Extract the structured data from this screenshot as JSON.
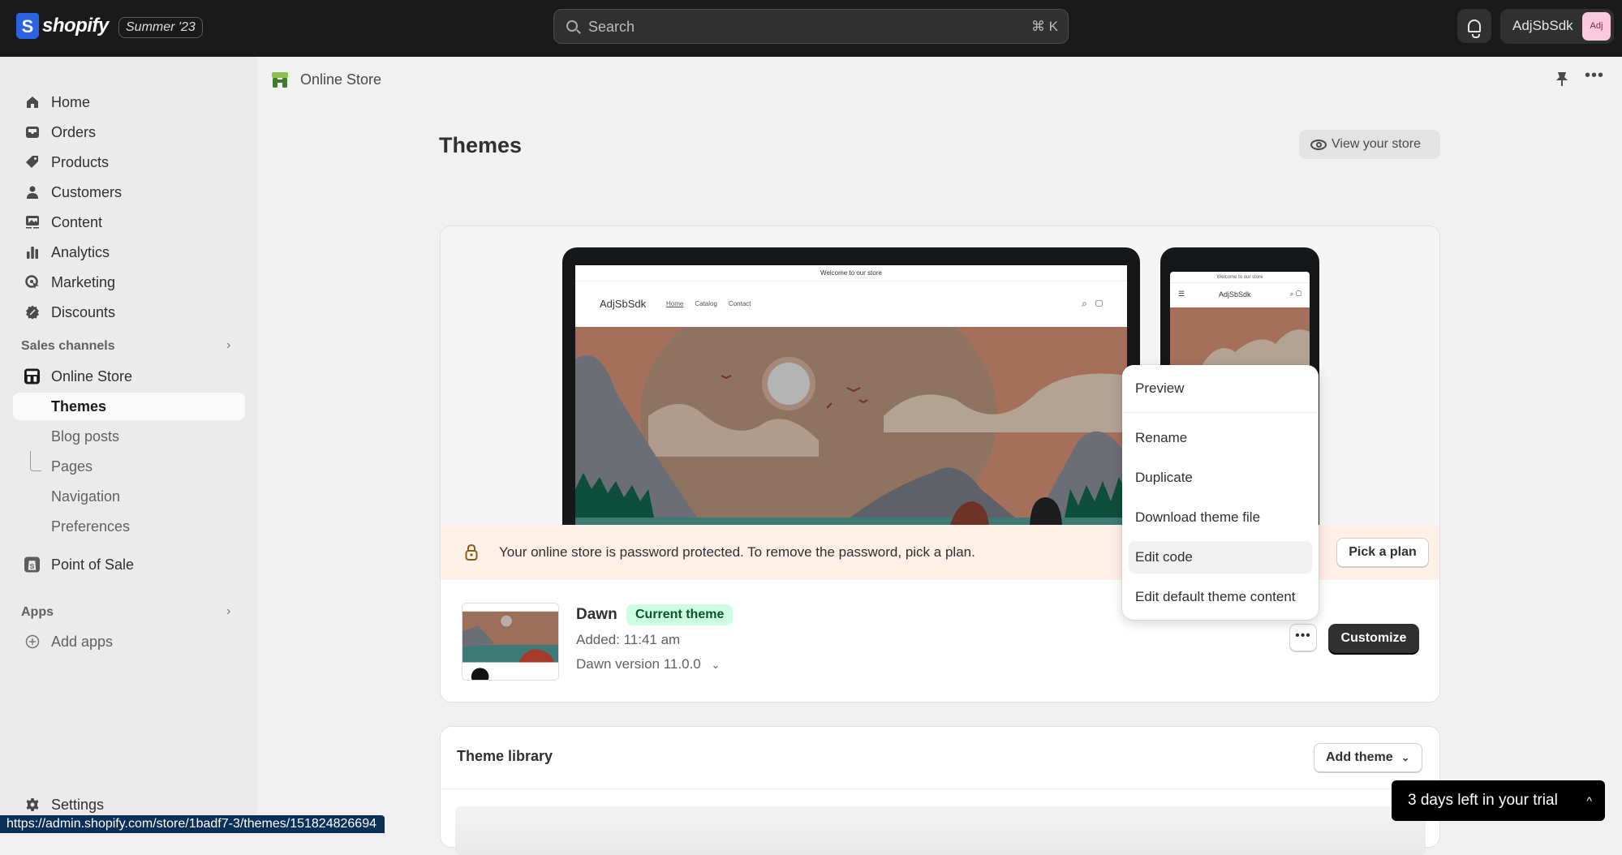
{
  "topbar": {
    "brand": "shopify",
    "edition": "Summer '23",
    "search_placeholder": "Search",
    "search_shortcut": "⌘ K",
    "account_name": "AdjSbSdk",
    "avatar_initials": "Adj"
  },
  "sidebar": {
    "main_items": [
      {
        "label": "Home",
        "icon": "home-icon"
      },
      {
        "label": "Orders",
        "icon": "inbox-icon"
      },
      {
        "label": "Products",
        "icon": "tag-icon"
      },
      {
        "label": "Customers",
        "icon": "person-icon"
      },
      {
        "label": "Content",
        "icon": "image-icon"
      },
      {
        "label": "Analytics",
        "icon": "bar-chart-icon"
      },
      {
        "label": "Marketing",
        "icon": "target-icon"
      },
      {
        "label": "Discounts",
        "icon": "discount-icon"
      }
    ],
    "sales_channels_heading": "Sales channels",
    "online_store": "Online Store",
    "online_store_sub": [
      {
        "label": "Themes",
        "active": true
      },
      {
        "label": "Blog posts"
      },
      {
        "label": "Pages"
      },
      {
        "label": "Navigation"
      },
      {
        "label": "Preferences"
      }
    ],
    "point_of_sale": "Point of Sale",
    "apps_heading": "Apps",
    "add_apps": "Add apps",
    "settings": "Settings"
  },
  "status_url": "https://admin.shopify.com/store/1badf7-3/themes/151824826694",
  "page": {
    "breadcrumb": "Online Store",
    "title": "Themes",
    "view_store_label": "View your store"
  },
  "preview": {
    "announcement": "Welcome to our store",
    "shop_name": "AdjSbSdk",
    "nav": [
      "Home",
      "Catalog",
      "Contact"
    ]
  },
  "banner": {
    "text": "Your online store is password protected. To remove the password, pick a plan.",
    "button": "Pick a plan"
  },
  "current_theme": {
    "name": "Dawn",
    "badge": "Current theme",
    "added": "Added: 11:41 am",
    "version": "Dawn version 11.0.0",
    "more_label": "•••",
    "customize_label": "Customize"
  },
  "theme_menu": {
    "items": [
      "Preview",
      "Rename",
      "Duplicate",
      "Download theme file",
      "Edit code",
      "Edit default theme content"
    ],
    "hovered": "Edit code"
  },
  "library": {
    "title": "Theme library",
    "add_theme": "Add theme"
  },
  "trial": {
    "text": "3 days left in your trial"
  },
  "colors": {
    "topbar_bg": "#1a1a1a",
    "badge_bg": "#cdfee1",
    "banner_bg": "#fff0e8",
    "primary_button": "#303030"
  }
}
